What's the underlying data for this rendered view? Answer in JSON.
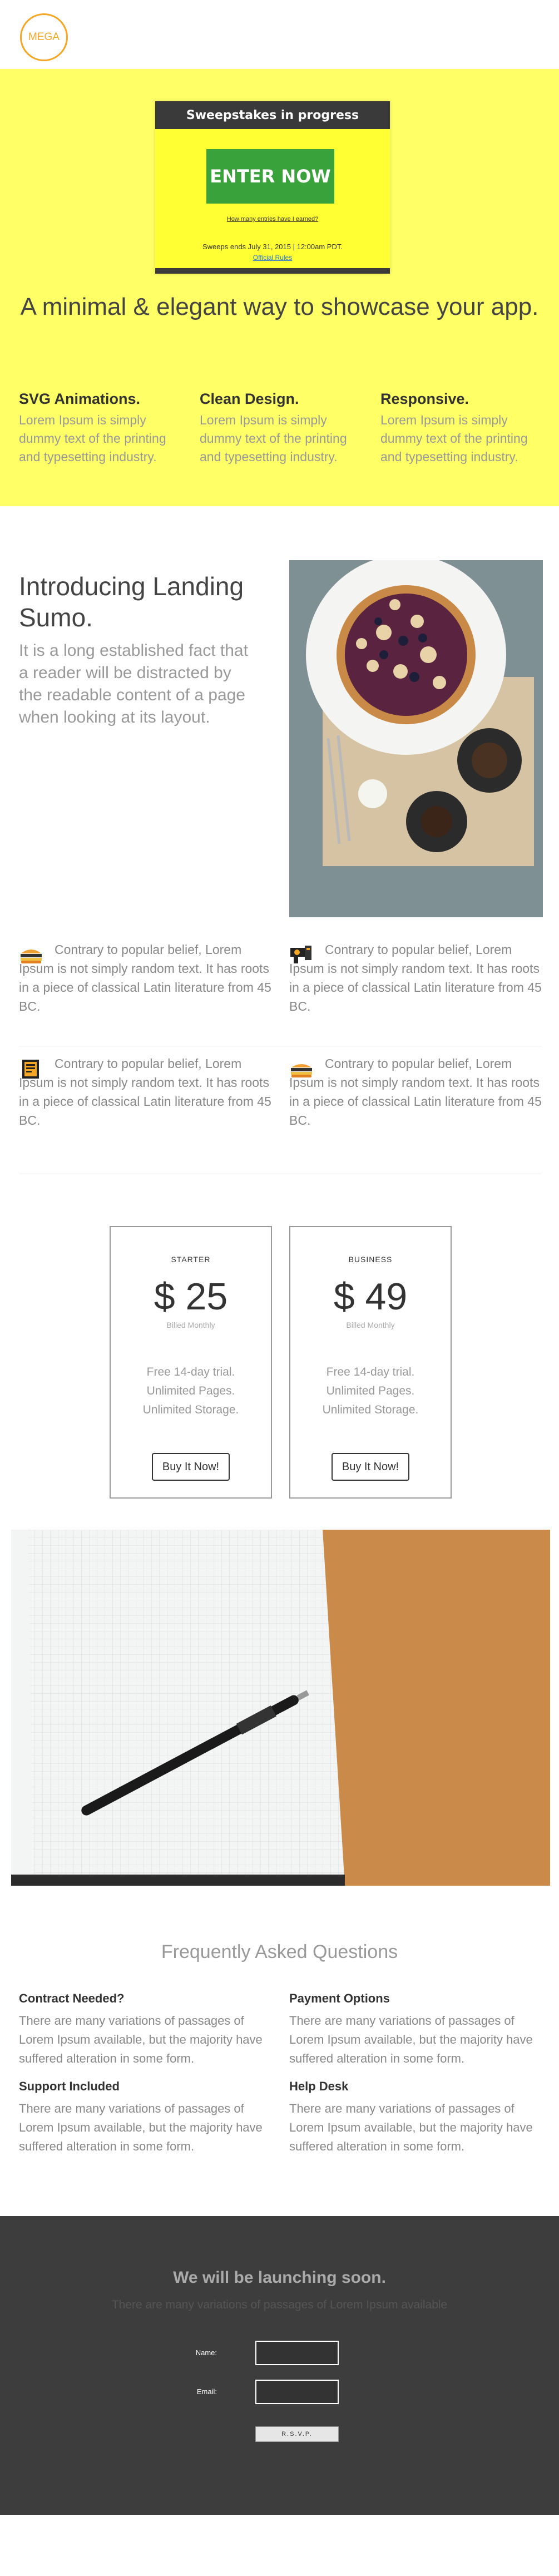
{
  "header": {
    "logo_text": "MEGA",
    "brand_color": "#f5a623"
  },
  "hero": {
    "bg_color": "#ffff66",
    "widget": {
      "heading": "Sweepstakes in progress",
      "enter_label": "ENTER NOW",
      "entries_link": "How many entries have I earned?",
      "ends_text": "Sweeps ends July 31, 2015 | 12:00am PDT.",
      "official_rules": "Official Rules"
    },
    "title": "A minimal & elegant way to showcase your app.",
    "features": [
      {
        "title": "SVG Animations.",
        "text": "Lorem Ipsum is simply dummy text of the printing and typesetting industry."
      },
      {
        "title": "Clean Design.",
        "text": "Lorem Ipsum is simply dummy text of the printing and typesetting industry."
      },
      {
        "title": "Responsive.",
        "text": "Lorem Ipsum is simply dummy text of the printing and typesetting industry."
      }
    ]
  },
  "intro": {
    "title": "Introducing Landing Sumo.",
    "text": "It is a long established fact that a reader will be distracted by the readable content of a page when looking at its layout."
  },
  "items": [
    {
      "icon": "burger-icon",
      "text": "Contrary to popular belief, Lorem Ipsum is not simply random text. It has roots in a piece of classical Latin literature from 45 BC."
    },
    {
      "icon": "camera-icon",
      "text": "Contrary to popular belief, Lorem Ipsum is not simply random text. It has roots in a piece of classical Latin literature from 45 BC."
    },
    {
      "icon": "notebook-icon",
      "text": "Contrary to popular belief, Lorem Ipsum is not simply random text. It has roots in a piece of classical Latin literature from 45 BC."
    },
    {
      "icon": "cake-icon",
      "text": "Contrary to popular belief, Lorem Ipsum is not simply random text. It has roots in a piece of classical Latin literature from 45 BC."
    }
  ],
  "pricing": [
    {
      "plan": "STARTER",
      "price": "$ 25",
      "billed": "Billed Monthly",
      "features": [
        "Free 14-day trial.",
        "Unlimited Pages.",
        "Unlimited Storage."
      ],
      "button": "Buy It Now!"
    },
    {
      "plan": "BUSINESS",
      "price": "$ 49",
      "billed": "Billed Monthly",
      "features": [
        "Free 14-day trial.",
        "Unlimited Pages.",
        "Unlimited Storage."
      ],
      "button": "Buy It Now!"
    }
  ],
  "faq": {
    "title": "Frequently Asked Questions",
    "items": [
      {
        "q": "Contract Needed?",
        "a": "There are many variations of passages of Lorem Ipsum available, but the majority have suffered alteration in some form."
      },
      {
        "q": "Payment Options",
        "a": "There are many variations of passages of Lorem Ipsum available, but the majority have suffered alteration in some form."
      },
      {
        "q": "Support Included",
        "a": "There are many variations of passages of Lorem Ipsum available, but the majority have suffered alteration in some form."
      },
      {
        "q": "Help Desk",
        "a": "There are many variations of passages of Lorem Ipsum available, but the majority have suffered alteration in some form."
      }
    ]
  },
  "footer": {
    "heading": "We will be launching soon.",
    "subtext": "There are many variations of passages of Lorem Ipsum available",
    "name_label": "Name:",
    "email_label": "Email:",
    "rsvp_label": "R.S.V.P."
  }
}
